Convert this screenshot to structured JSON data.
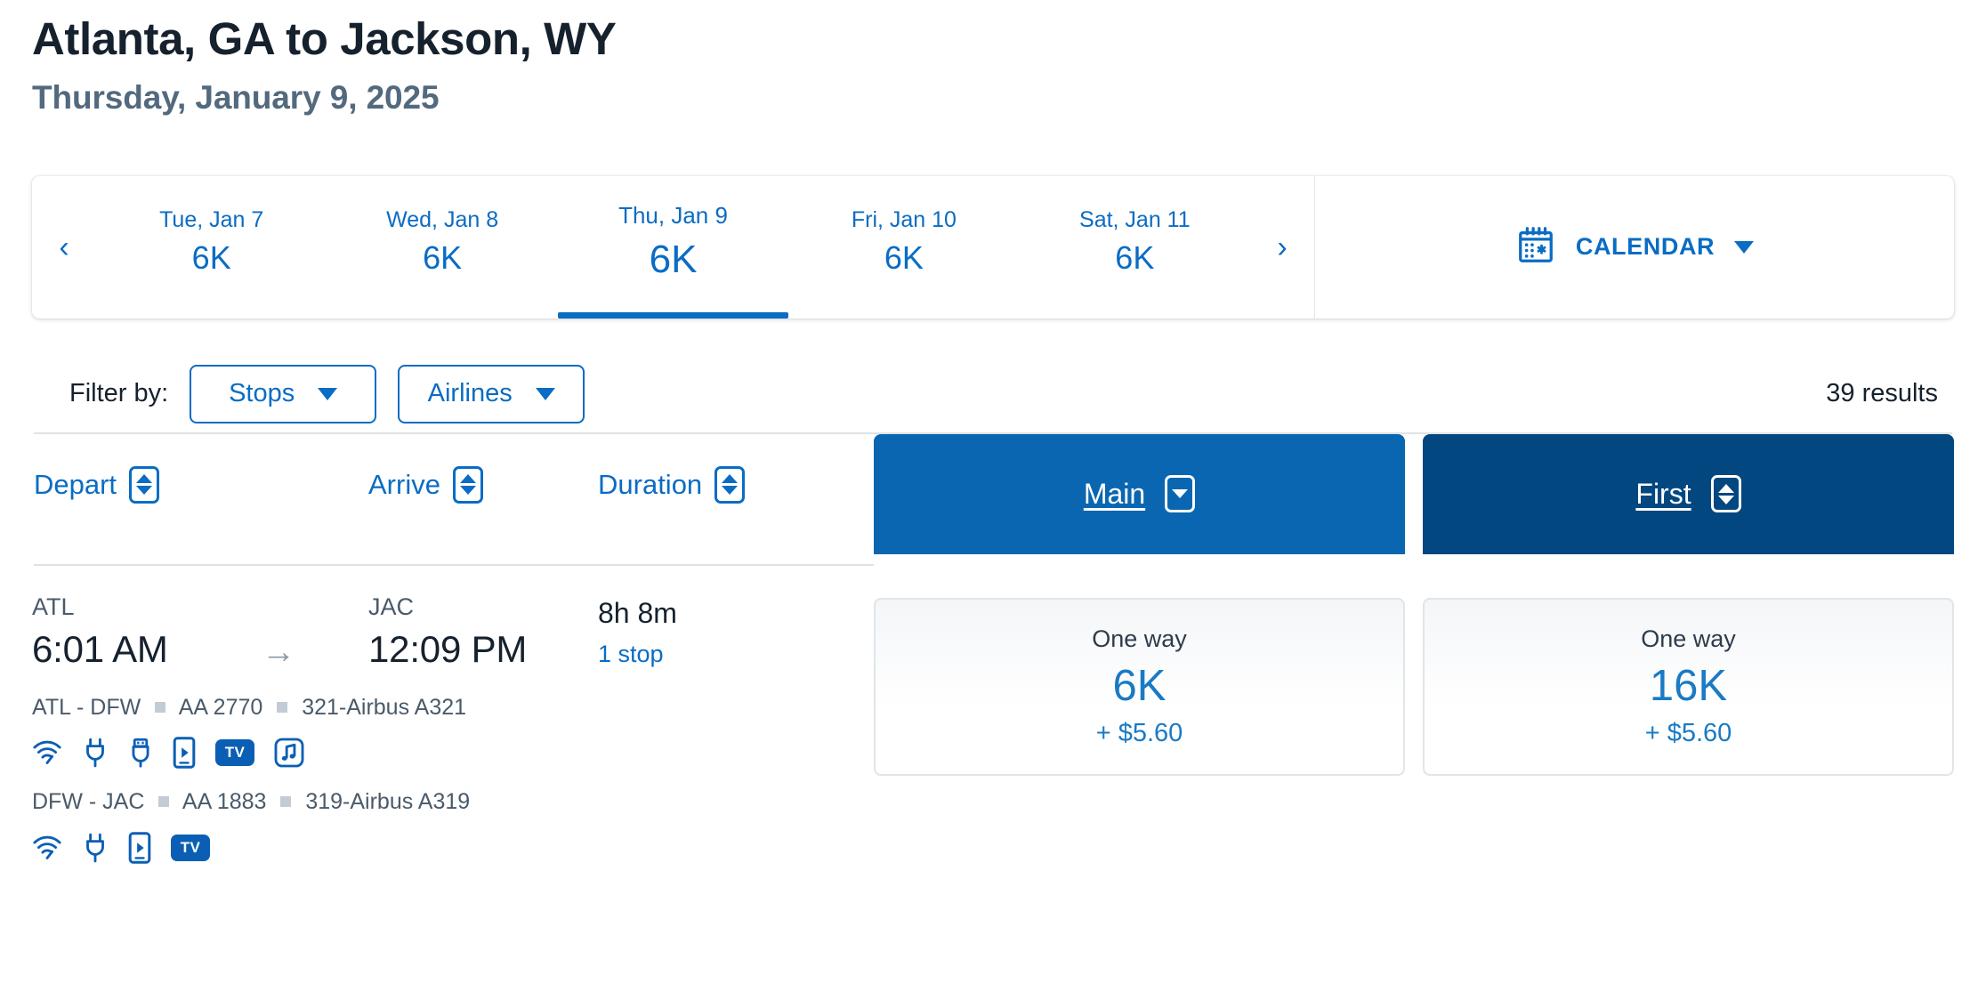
{
  "header": {
    "title": "Atlanta, GA to Jackson, WY",
    "subtitle": "Thursday, January 9, 2025"
  },
  "date_strip": {
    "prev_icon": "‹",
    "next_icon": "›",
    "days": [
      {
        "label": "Tue, Jan 7",
        "price": "6K",
        "selected": false
      },
      {
        "label": "Wed, Jan 8",
        "price": "6K",
        "selected": false
      },
      {
        "label": "Thu, Jan 9",
        "price": "6K",
        "selected": true
      },
      {
        "label": "Fri, Jan 10",
        "price": "6K",
        "selected": false
      },
      {
        "label": "Sat, Jan 11",
        "price": "6K",
        "selected": false
      }
    ],
    "calendar": {
      "label": "CALENDAR",
      "icon": "calendar-icon",
      "caret": "chevron-down-icon"
    }
  },
  "filters": {
    "label": "Filter by:",
    "buttons": [
      {
        "label": "Stops",
        "caret": "chevron-down-icon"
      },
      {
        "label": "Airlines",
        "caret": "chevron-down-icon"
      }
    ],
    "results_count": "39 results"
  },
  "table": {
    "sort_columns": [
      {
        "label": "Depart",
        "sort": "both"
      },
      {
        "label": "Arrive",
        "sort": "both"
      },
      {
        "label": "Duration",
        "sort": "both"
      }
    ],
    "fare_classes": [
      {
        "label": "Main",
        "sort": "down",
        "color": "#0a66b0"
      },
      {
        "label": "First",
        "sort": "both",
        "color": "#034780"
      }
    ]
  },
  "flights": [
    {
      "depart_airport": "ATL",
      "depart_time": "6:01 AM",
      "arrow": "→",
      "arrive_airport": "JAC",
      "arrive_time": "12:09 PM",
      "duration": "8h 8m",
      "stops": "1 stop",
      "segments": [
        {
          "route": "ATL - DFW",
          "flight_number": "AA 2770",
          "aircraft": "321-Airbus A321",
          "amenities": [
            "wifi-icon",
            "power-outlet-icon",
            "usb-port-icon",
            "streaming-device-icon",
            "tv-icon",
            "music-icon"
          ]
        },
        {
          "route": "DFW - JAC",
          "flight_number": "AA 1883",
          "aircraft": "319-Airbus A319",
          "amenities": [
            "wifi-icon",
            "power-outlet-icon",
            "streaming-device-icon",
            "tv-icon"
          ]
        }
      ],
      "fares": [
        {
          "class": "Main",
          "type": "One way",
          "points": "6K",
          "taxes": "+ $5.60"
        },
        {
          "class": "First",
          "type": "One way",
          "points": "16K",
          "taxes": "+ $5.60"
        }
      ]
    }
  ],
  "colors": {
    "link_blue": "#0a6cc4",
    "main_header": "#0a66b0",
    "first_header": "#034780",
    "price_blue": "#1a7ac4",
    "subtitle_slate": "#53697e",
    "title_dark": "#16212e"
  }
}
